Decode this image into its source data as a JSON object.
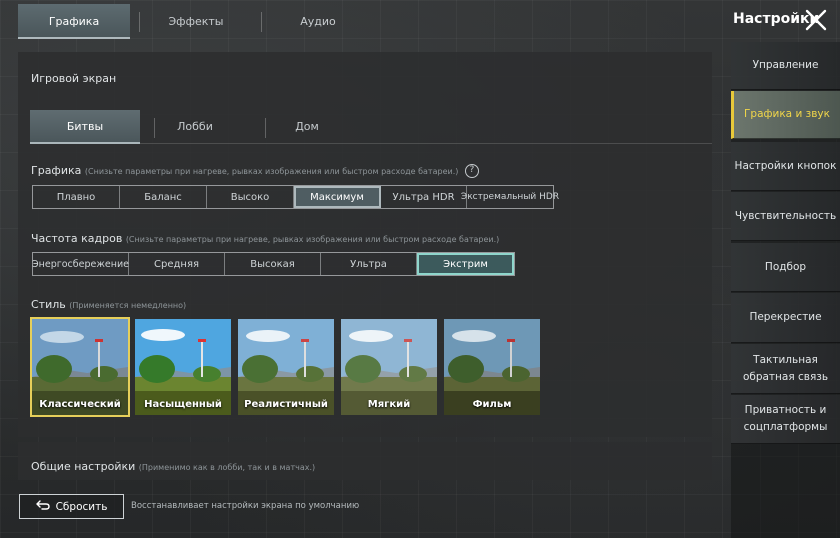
{
  "top_tabs": [
    {
      "label": "Графика",
      "active": true
    },
    {
      "label": "Эффекты",
      "active": false
    },
    {
      "label": "Аудио",
      "active": false
    }
  ],
  "header": {
    "title": "Настройки",
    "close_icon": "close-icon"
  },
  "sidebar": {
    "items": [
      {
        "label": "Управление",
        "active": false
      },
      {
        "label": "Графика и звук",
        "active": true
      },
      {
        "label": "Настройки кнопок",
        "active": false
      },
      {
        "label": "Чувствительность",
        "active": false
      },
      {
        "label": "Подбор",
        "active": false
      },
      {
        "label": "Перекрестие",
        "active": false
      },
      {
        "label": "Тактильная обратная связь",
        "active": false
      },
      {
        "label": "Приватность и соцплатформы",
        "active": false
      }
    ]
  },
  "game_screen": {
    "title": "Игровой экран",
    "sub_tabs": [
      {
        "label": "Битвы",
        "active": true
      },
      {
        "label": "Лобби",
        "active": false
      },
      {
        "label": "Дом",
        "active": false
      }
    ]
  },
  "graphics": {
    "label": "Графика",
    "note": "(Снизьте параметры при нагреве, рывках изображения или быстром расходе батареи.)",
    "help_icon": "?",
    "options": [
      "Плавно",
      "Баланс",
      "Высоко",
      "Максимум",
      "Ультра HDR",
      "Экстремальный HDR"
    ],
    "selected": "Максимум"
  },
  "frame_rate": {
    "label": "Частота кадров",
    "note": "(Снизьте параметры при нагреве, рывках изображения или быстром расходе батареи.)",
    "options": [
      "Энергосбережение",
      "Средняя",
      "Высокая",
      "Ультра",
      "Экстрим"
    ],
    "selected": "Экстрим"
  },
  "style": {
    "label": "Стиль",
    "note": "(Применяется немедленно)",
    "options": [
      "Классический",
      "Насыщенный",
      "Реалистичный",
      "Мягкий",
      "Фильм"
    ],
    "selected": "Классический"
  },
  "general": {
    "label": "Общие настройки",
    "note": "(Применимо как в лобби, так и в матчах.)"
  },
  "reset": {
    "label": "Сбросить",
    "description": "Восстанавливает настройки экрана по умолчанию"
  },
  "colors": {
    "accent_yellow": "#e8c93a",
    "selected_teal": "#8fd6cc",
    "panel_bg": "#2c2e2f"
  }
}
